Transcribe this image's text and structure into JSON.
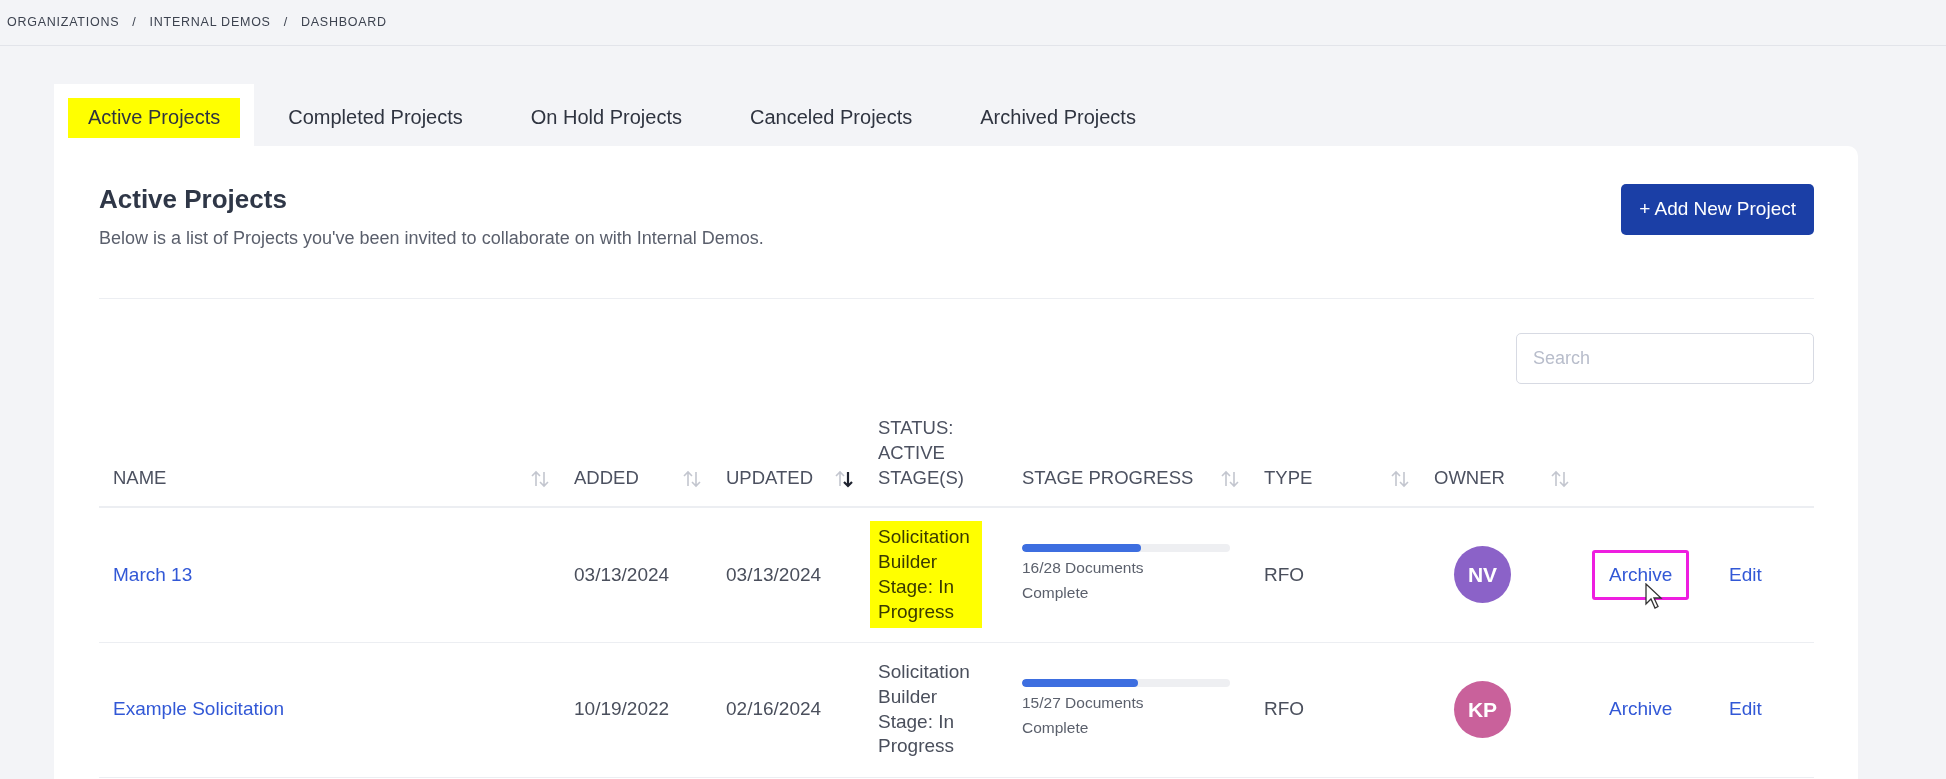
{
  "breadcrumb": [
    "ORGANIZATIONS",
    "INTERNAL DEMOS",
    "DASHBOARD"
  ],
  "breadcrumb_separator": "/",
  "tabs": [
    {
      "label": "Active Projects",
      "selected": true,
      "highlighted": true
    },
    {
      "label": "Completed Projects",
      "selected": false,
      "highlighted": false
    },
    {
      "label": "On Hold Projects",
      "selected": false,
      "highlighted": false
    },
    {
      "label": "Canceled Projects",
      "selected": false,
      "highlighted": false
    },
    {
      "label": "Archived Projects",
      "selected": false,
      "highlighted": false
    }
  ],
  "panel": {
    "title": "Active Projects",
    "subtitle": "Below is a list of Projects you've been invited to collaborate on with Internal Demos.",
    "add_button": "+ Add New Project"
  },
  "search": {
    "placeholder": "Search"
  },
  "table": {
    "columns": [
      {
        "label": "NAME",
        "sortable": true,
        "sorted_desc": false
      },
      {
        "label": "ADDED",
        "sortable": true,
        "sorted_desc": false
      },
      {
        "label": "UPDATED",
        "sortable": true,
        "sorted_desc": true
      },
      {
        "label": "STATUS: ACTIVE STAGE(S)",
        "sortable": false
      },
      {
        "label": "STAGE PROGRESS",
        "sortable": true,
        "sorted_desc": false
      },
      {
        "label": "TYPE",
        "sortable": true,
        "sorted_desc": false
      },
      {
        "label": "OWNER",
        "sortable": true,
        "sorted_desc": false
      }
    ],
    "rows": [
      {
        "name": "March 13",
        "added": "03/13/2024",
        "updated": "03/13/2024",
        "status": "Solicitation Builder Stage: In Progress",
        "status_highlighted": true,
        "level": 0.57,
        "progress_text": "16/28 Documents Complete",
        "type": "RFO",
        "owner": "NV",
        "color": "#8b62c8",
        "archive": "Archive",
        "archive_outlined": true,
        "pointer_over_archive": true,
        "edit": "Edit"
      },
      {
        "name": "Example Solicitation",
        "added": "10/19/2022",
        "updated": "02/16/2024",
        "status": "Solicitation Builder Stage: In Progress",
        "status_highlighted": false,
        "level": 0.56,
        "progress_text": "15/27 Documents Complete",
        "type": "RFO",
        "owner": "KP",
        "color": "#c9619b",
        "archive": "Archive",
        "archive_outlined": false,
        "pointer_over_archive": false,
        "edit": "Edit"
      }
    ]
  }
}
